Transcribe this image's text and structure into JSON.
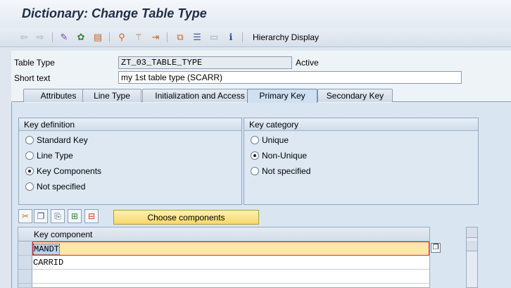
{
  "title": "Dictionary: Change Table Type",
  "toolbar": {
    "hierarchy_label": "Hierarchy Display",
    "icons": [
      "back-arrow-icon",
      "forward-arrow-icon",
      "edit-glasses-icon",
      "activate-icon",
      "object-list-icon",
      "where-used-icon",
      "magic-wand-icon",
      "navigate-icon",
      "hierarchy-icon",
      "list-icon",
      "layout-icon",
      "info-icon"
    ]
  },
  "header": {
    "table_type_label": "Table Type",
    "table_type_value": "ZT_03_TABLE_TYPE",
    "status": "Active",
    "short_text_label": "Short text",
    "short_text_value": "my 1st table type (SCARR)"
  },
  "tabs": [
    {
      "label": "Attributes",
      "active": false
    },
    {
      "label": "Line Type",
      "active": false
    },
    {
      "label": "Initialization and Access",
      "active": false
    },
    {
      "label": "Primary Key",
      "active": true
    },
    {
      "label": "Secondary Key",
      "active": false
    }
  ],
  "key_definition": {
    "title": "Key definition",
    "options": [
      {
        "label": "Standard Key",
        "selected": false
      },
      {
        "label": "Line Type",
        "selected": false
      },
      {
        "label": "Key Components",
        "selected": true
      },
      {
        "label": "Not specified",
        "selected": false
      }
    ]
  },
  "key_category": {
    "title": "Key category",
    "options": [
      {
        "label": "Unique",
        "selected": false
      },
      {
        "label": "Non-Unique",
        "selected": true
      },
      {
        "label": "Not specified",
        "selected": false
      }
    ]
  },
  "table_controls": {
    "icons": [
      "cut-icon",
      "copy-icon",
      "paste-icon",
      "insert-row-icon",
      "delete-row-icon"
    ],
    "choose_components_label": "Choose components"
  },
  "grid": {
    "column_header": "Key component",
    "rows": [
      "MANDT",
      "CARRID",
      "",
      ""
    ]
  },
  "colors": {
    "accent_yellow": "#f6d86a",
    "focus_border": "#dd2244",
    "panel_blue": "#d9e6f2"
  }
}
